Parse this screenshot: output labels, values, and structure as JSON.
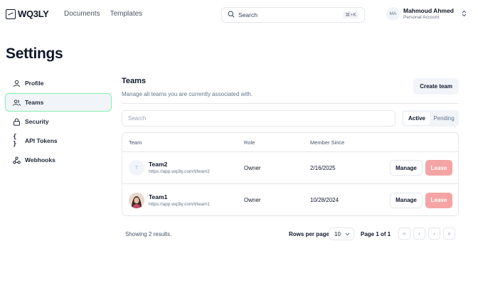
{
  "header": {
    "logo_text": "WQ3LY",
    "nav": [
      "Documents",
      "Templates"
    ],
    "search_label": "Search",
    "search_shortcut": "⌘+K",
    "user": {
      "initials": "MA",
      "name": "Mahmoud Ahmed",
      "account_type": "Personal Account"
    }
  },
  "page_title": "Settings",
  "sidebar": {
    "items": [
      {
        "label": "Profile",
        "icon": "user-icon"
      },
      {
        "label": "Teams",
        "icon": "users-icon",
        "active": true
      },
      {
        "label": "Security",
        "icon": "lock-icon"
      },
      {
        "label": "API Tokens",
        "icon": "braces-icon"
      },
      {
        "label": "Webhooks",
        "icon": "webhook-icon"
      }
    ]
  },
  "teams": {
    "title": "Teams",
    "subtitle": "Manage all teams you are currently associated with.",
    "create_label": "Create team",
    "search_placeholder": "Search",
    "filters": [
      "Active",
      "Pending"
    ],
    "active_filter": "Active",
    "columns": [
      "Team",
      "Role",
      "Member Since"
    ],
    "rows": [
      {
        "avatar": "T",
        "name": "Team2",
        "url": "https://app.wq3ly.com/t/team2",
        "role": "Owner",
        "member_since": "2/16/2025",
        "manage": "Manage",
        "leave": "Leave"
      },
      {
        "avatar": "photo",
        "name": "Team1",
        "url": "https://app.wq3ly.com/t/team1",
        "role": "Owner",
        "member_since": "10/28/2024",
        "manage": "Manage",
        "leave": "Leave"
      }
    ],
    "results_text": "Showing 2 results.",
    "rows_per_page_label": "Rows per page",
    "rows_per_page": "10",
    "page_info": "Page 1 of 1"
  },
  "colors": {
    "accent_border": "#86efac",
    "leave_bg": "#f4a4a4"
  }
}
